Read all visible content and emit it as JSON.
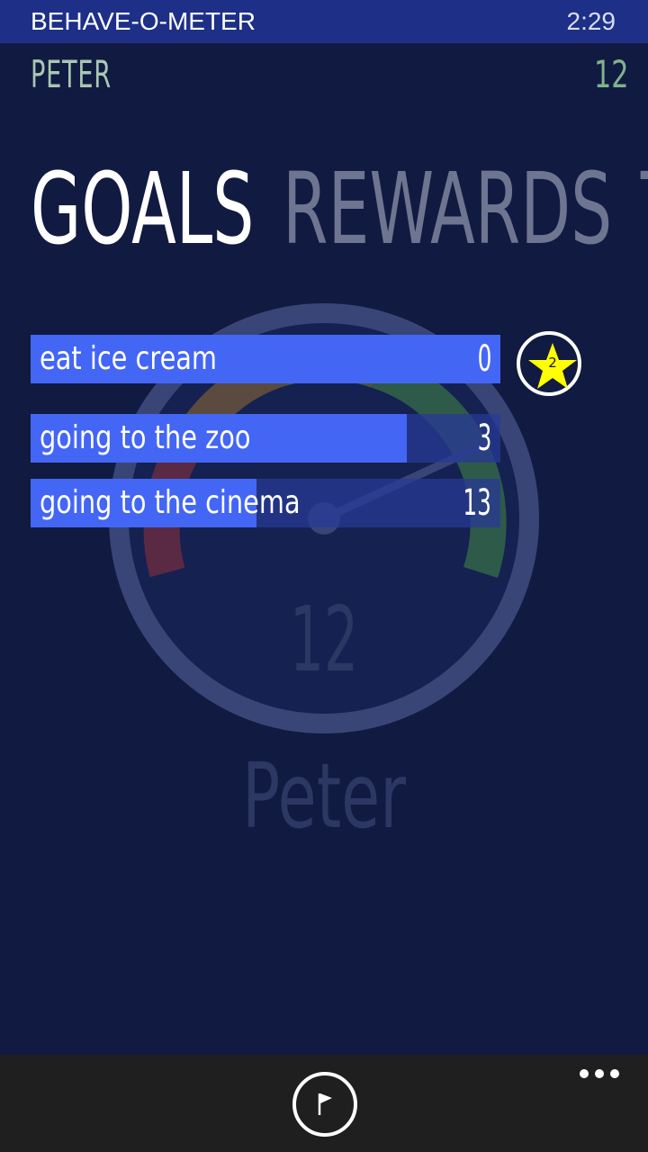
{
  "status_bar": {
    "app_title": "BEHAVE-O-METER",
    "time": "2:29"
  },
  "header": {
    "child_name": "PETER",
    "score": "12"
  },
  "pivot_tabs": [
    "GOALS",
    "REWARDS",
    "TODA"
  ],
  "gauge": {
    "score": "12",
    "name": "Peter"
  },
  "goals": [
    {
      "label": "eat ice cream",
      "value": "0",
      "progress": 1.0
    },
    {
      "label": "going to the zoo",
      "value": "3",
      "progress": 0.8
    },
    {
      "label": "going to the cinema",
      "value": "13",
      "progress": 0.48
    }
  ],
  "star_badge": {
    "count": "2",
    "color": "#ffff00"
  },
  "app_bar": {
    "primary_icon": "flag-icon",
    "more_icon": "more-dots-icon"
  },
  "colors": {
    "background": "#111a40",
    "status_bar": "#1d2f87",
    "goal_fill": "#4466f5"
  }
}
